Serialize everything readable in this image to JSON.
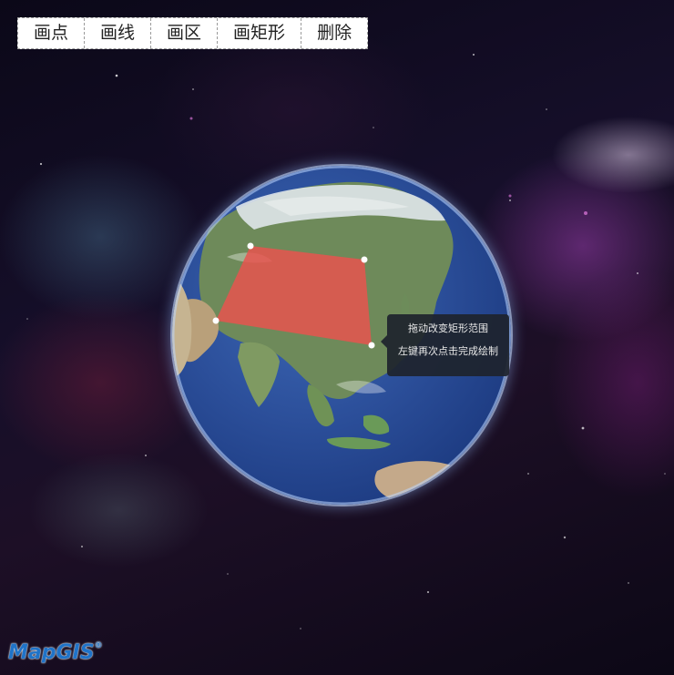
{
  "toolbar": {
    "buttons": [
      {
        "label": "画点"
      },
      {
        "label": "画线"
      },
      {
        "label": "画区"
      },
      {
        "label": "画矩形"
      },
      {
        "label": "删除"
      }
    ]
  },
  "tooltip": {
    "line1": "拖动改变矩形范围",
    "line2": "左键再次点击完成绘制"
  },
  "logo": {
    "text": "MapGIS",
    "registered": "®"
  },
  "colors": {
    "rectangle_fill": "#e8534f",
    "ocean": "#2b4e99",
    "toolbar_bg": "#ffffff",
    "tooltip_bg": "#1e232d",
    "logo": "#1f73c8"
  }
}
